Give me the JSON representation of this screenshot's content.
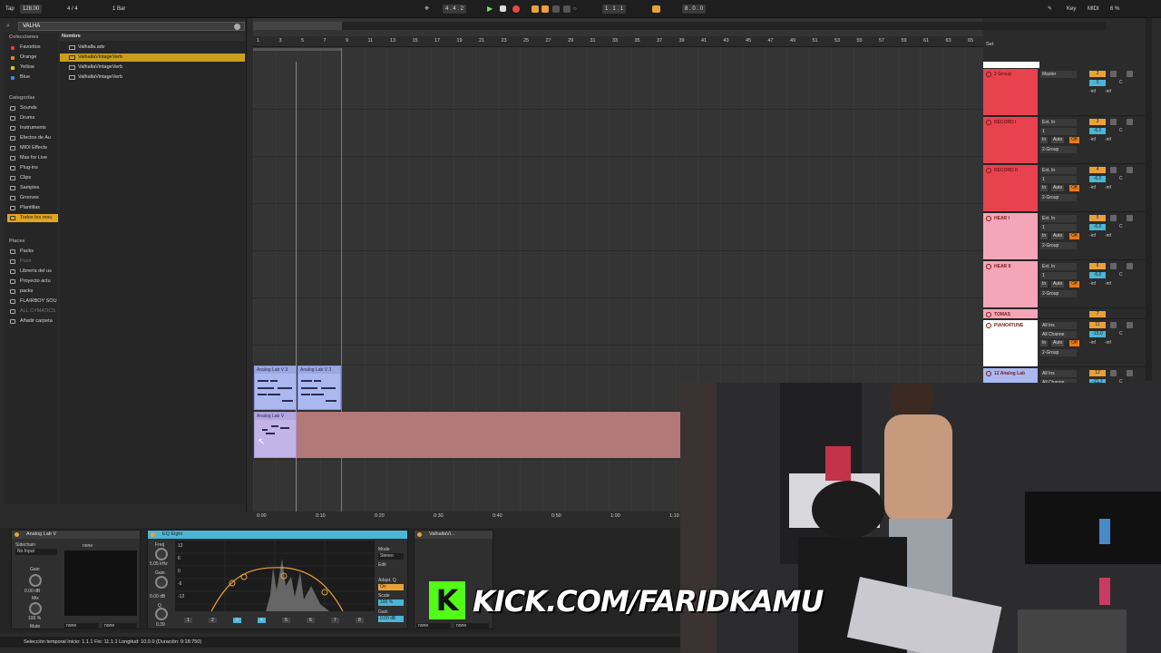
{
  "transport": {
    "tap": "Tap",
    "tempo": "128.00",
    "meter": "4 / 4",
    "quantize": "1 Bar",
    "position": "4 . 4 . 2",
    "loop_start": "1 . 1 . 1",
    "loop_length": "8 . 0 . 0",
    "key": "Key",
    "midi": "MIDI",
    "cpu": "6 %"
  },
  "browser": {
    "search_value": "VALHA",
    "collections_header": "Colecciones",
    "collections": [
      {
        "label": "Favoritos",
        "color": "#e23b3b"
      },
      {
        "label": "Orange",
        "color": "#e8871e"
      },
      {
        "label": "Yellow",
        "color": "#e2c51e"
      },
      {
        "label": "Blue",
        "color": "#3a8de2"
      }
    ],
    "categories_header": "Categorías",
    "categories": [
      "Sounds",
      "Drums",
      "Instruments",
      "Efectos de Au",
      "MIDI Effects",
      "Max for Live",
      "Plug-ins",
      "Clips",
      "Samples",
      "Grooves",
      "Plantillas",
      "Todos los resu"
    ],
    "places_header": "Places",
    "places": [
      "Packs",
      "Push",
      "Librería del us",
      "Proyecto actu",
      "packs",
      "FLAIRBOY SOU",
      "ALL CYMATICS",
      "Añadir carpeta"
    ],
    "name_header": "Nombre",
    "files": [
      "Valhalla.adv",
      "ValhallaVintageVerb",
      "ValhallaVintageVerb",
      "ValhallaVintageVerb"
    ]
  },
  "ruler": [
    "1",
    "3",
    "5",
    "7",
    "9",
    "11",
    "13",
    "15",
    "17",
    "19",
    "21",
    "23",
    "25",
    "27",
    "29",
    "31",
    "33",
    "35",
    "37",
    "39",
    "41",
    "43",
    "45",
    "47",
    "49",
    "51",
    "53",
    "55",
    "57",
    "59",
    "61",
    "63",
    "65"
  ],
  "time_ruler": [
    "0:00",
    "0:10",
    "0:20",
    "0:30",
    "0:40",
    "0:50",
    "1:00",
    "1:10"
  ],
  "clips": {
    "clip1": "Analog Lab V 3",
    "clip2": "Analog Lab V 3",
    "clip3": "Analog Lab V"
  },
  "mixer": {
    "set_label": "Set",
    "tracks": [
      {
        "num": "2",
        "name": "2 Group",
        "color": "#e8424f",
        "io_in": "Master",
        "ch": "",
        "vol": "0",
        "pan": "C",
        "rec1": "-inf",
        "rec2": "-inf",
        "route": ""
      },
      {
        "num": "3",
        "name": "RECORD I",
        "color": "#e8424f",
        "io_in": "Ext. In",
        "ch": "1",
        "vol": "-6.0",
        "pan": "C",
        "rec1": "-inf",
        "rec2": "-inf",
        "route": "2-Group"
      },
      {
        "num": "4",
        "name": "RECORD II",
        "color": "#e8424f",
        "io_in": "Ext. In",
        "ch": "1",
        "vol": "-6.0",
        "pan": "C",
        "rec1": "-inf",
        "rec2": "-inf",
        "route": "2-Group"
      },
      {
        "num": "5",
        "name": "HEAR I",
        "color": "#f4a6b8",
        "io_in": "Ext. In",
        "ch": "1",
        "vol": "-6.0",
        "pan": "C",
        "rec1": "-inf",
        "rec2": "-inf",
        "route": "2-Group"
      },
      {
        "num": "6",
        "name": "HEAR II",
        "color": "#f4a6b8",
        "io_in": "Ext. In",
        "ch": "1",
        "vol": "-6.0",
        "pan": "C",
        "rec1": "-inf",
        "rec2": "-inf",
        "route": "2-Group"
      },
      {
        "num": "7",
        "name": "TOMAS",
        "color": "#f4a6b8",
        "io_in": "",
        "ch": "",
        "vol": "",
        "pan": "",
        "rec1": "",
        "rec2": "",
        "route": ""
      },
      {
        "num": "11",
        "name": "PIANO4TUNE",
        "color": "#ffffff",
        "io_in": "All Ins",
        "ch": "All Channe",
        "vol": "-15.0",
        "pan": "C",
        "rec1": "-inf",
        "rec2": "-inf",
        "route": "2-Group"
      },
      {
        "num": "12",
        "name": "12 Analog Lab",
        "color": "#aab8ef",
        "io_in": "All Ins",
        "ch": "All Channe",
        "vol": "-21.7",
        "pan": "C",
        "rec1": "",
        "rec2": "",
        "route": ""
      }
    ],
    "monitor_in": "In",
    "monitor_auto": "Auto",
    "monitor_off": "Off"
  },
  "devices": {
    "analog_lab": {
      "title": "Analog Lab V",
      "sidechain": "Sidechain",
      "no_input": "No Input",
      "none1": "none",
      "gain_label": "Gain",
      "gain_value": "0.00 dB",
      "mix_label": "Mix",
      "mix_value": "100 %",
      "mute": "Mute",
      "dd1": "none",
      "dd2": "none"
    },
    "eq_eight": {
      "title": "EQ Eight",
      "freq_label": "Freq",
      "freq_value": "5.05 kHz",
      "gain_label": "Gain",
      "gain_value": "0.00 dB",
      "q_label": "Q",
      "q_value": "0.39",
      "mode_label": "Mode",
      "mode_value": "Stereo",
      "edit_label": "Edit",
      "adapt_label": "Adapt. Q",
      "adapt_value": "On",
      "scale_label": "Scale",
      "scale_value": "100 %",
      "gain2_label": "Gain",
      "gain2_value": "0.00 dB",
      "bands": [
        "1",
        "2",
        "3",
        "4",
        "5",
        "6",
        "7",
        "8"
      ],
      "db_ticks": [
        "12",
        "6",
        "0",
        "-6",
        "-12"
      ]
    },
    "valhalla": {
      "title": "ValhallaVi...",
      "dd1": "none",
      "dd2": "none"
    }
  },
  "status": {
    "text": "Selección temporal   Inicio: 1.1.1    Fin: 11.1.1    Longitud: 10.0.0  (Duración: 0:18:750)"
  },
  "overlay": {
    "kick_text": "KICK.COM/FARIDKAMU"
  },
  "colors": {
    "accent": "#e8a13a",
    "selection": "#c99f1c",
    "clip_blue": "#aab8ef",
    "clip_red": "#b37878",
    "kick_green": "#53fc18"
  }
}
